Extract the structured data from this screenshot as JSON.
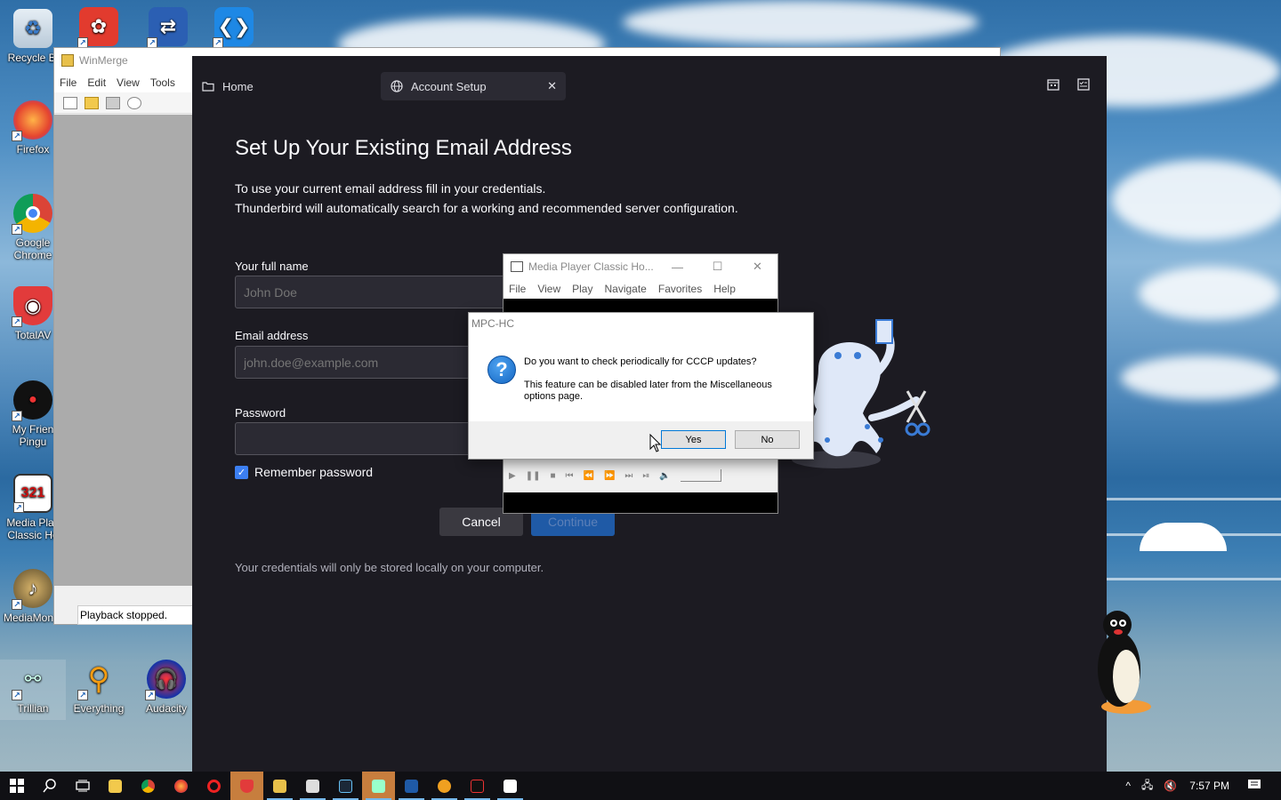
{
  "desktop": {
    "icons": [
      {
        "label": "Recycle Bin",
        "display": "Recycle Bi"
      },
      {
        "label": "Firefox"
      },
      {
        "label": "Google Chrome"
      },
      {
        "label": "TotalAV"
      },
      {
        "label": "My Friend Pingu",
        "display": "My Frien Pingu"
      },
      {
        "label": "Media Player Classic Ho",
        "display": "Media Play Classic Ho"
      },
      {
        "label": "MediaMon...",
        "display": "MediaMon..."
      },
      {
        "label": "Trillian"
      },
      {
        "label": "Everything"
      },
      {
        "label": "Audacity"
      }
    ]
  },
  "winmerge": {
    "title": "WinMerge",
    "menu": [
      "File",
      "Edit",
      "View",
      "Tools"
    ],
    "status": "Playback stopped."
  },
  "thunderbird": {
    "tabs": [
      {
        "label": "Home",
        "icon": "folder-icon"
      },
      {
        "label": "Account Setup",
        "icon": "globe-icon",
        "close": "✕"
      }
    ],
    "setup": {
      "title": "Set Up Your Existing Email Address",
      "desc1": "To use your current email address fill in your credentials.",
      "desc2": "Thunderbird will automatically search for a working and recommended server configuration.",
      "name_label": "Your full name",
      "name_placeholder": "John Doe",
      "email_label": "Email address",
      "email_placeholder": "john.doe@example.com",
      "password_label": "Password",
      "remember_label": "Remember password",
      "remember_checked": true,
      "cancel": "Cancel",
      "continue": "Continue",
      "note": "Your credentials will only be stored locally on your computer."
    }
  },
  "mpc": {
    "title": "Media Player Classic Ho...",
    "menu": [
      "File",
      "View",
      "Play",
      "Navigate",
      "Favorites",
      "Help"
    ]
  },
  "dialog": {
    "title": "MPC-HC",
    "question": "Do you want to check periodically for CCCP updates?",
    "sub": "This feature can be disabled later from the Miscellaneous options page.",
    "yes": "Yes",
    "no": "No"
  },
  "taskbar": {
    "time": "7:57 PM"
  },
  "colors": {
    "thunderbird_bg": "#1c1b22",
    "accent": "#3c7ff2",
    "taskbar": "#101014"
  }
}
